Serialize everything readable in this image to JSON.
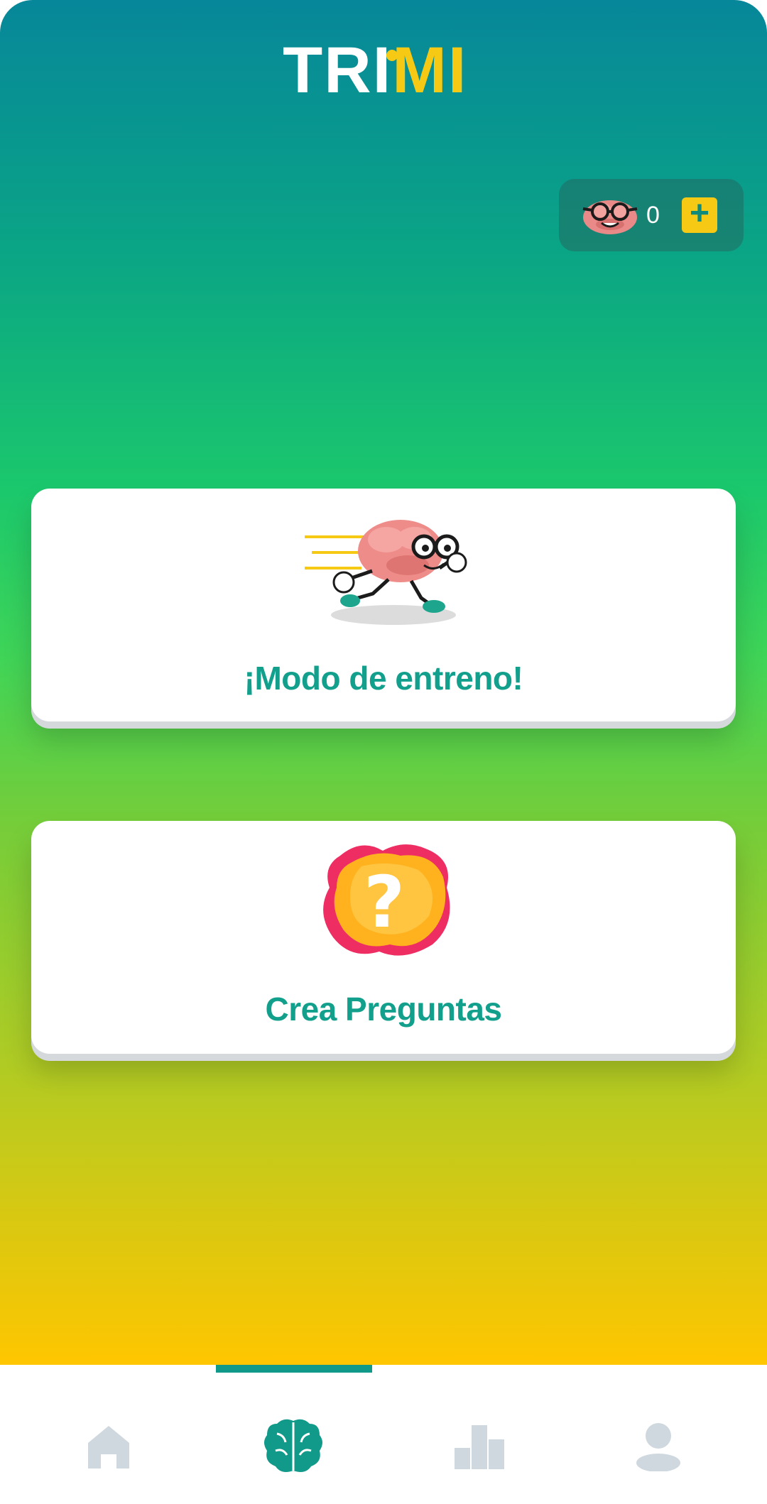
{
  "app": {
    "logo_text_white": "TRI",
    "logo_text_yellow": "MI",
    "colors": {
      "teal": "#12a08d",
      "yellow": "#f6c915",
      "icon_inactive": "#cfd8de"
    }
  },
  "coins": {
    "count": "0",
    "plus_label": "+",
    "mascot_icon": "brain-glasses-icon"
  },
  "cards": [
    {
      "title": "¡Modo de entreno!",
      "icon": "running-brain-icon"
    },
    {
      "title": "Crea Preguntas",
      "icon": "question-mark-icon"
    }
  ],
  "tabbar": {
    "active_index": 1,
    "tabs": [
      {
        "icon": "home-icon"
      },
      {
        "icon": "brain-icon"
      },
      {
        "icon": "podium-icon"
      },
      {
        "icon": "profile-icon"
      }
    ]
  }
}
